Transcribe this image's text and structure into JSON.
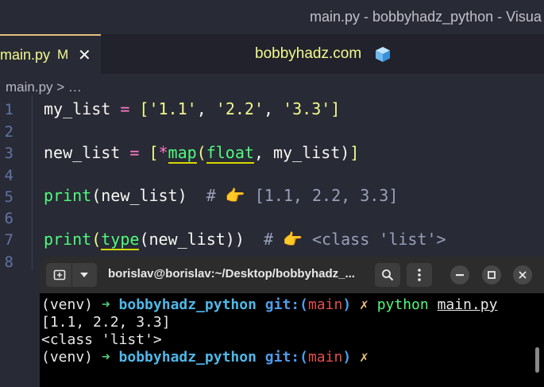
{
  "window": {
    "title": "main.py - bobbyhadz_python - Visua"
  },
  "tabs": [
    {
      "label": "main.py",
      "modified": "M"
    }
  ],
  "center_title": "bobbyhadz.com",
  "breadcrumb": "main.py > …",
  "editor": {
    "line_numbers": [
      "1",
      "2",
      "3",
      "4",
      "5",
      "6",
      "7",
      "8"
    ],
    "line1": {
      "var": "my_list",
      "op": " = ",
      "open": "[",
      "s1": "'1.1'",
      "c1": ", ",
      "s2": "'2.2'",
      "c2": ", ",
      "s3": "'3.3'",
      "close": "]"
    },
    "line3": {
      "var": "new_list",
      "op": " = ",
      "open": "[",
      "star": "*",
      "map": "map",
      "p1": "(",
      "float": "float",
      "rest": ", my_list)",
      "close": "]"
    },
    "line5": {
      "fn": "print",
      "args": "(new_list)",
      "comment": "  # 👉 [1.1, 2.2, 3.3]"
    },
    "line7": {
      "fn": "print",
      "p1": "(",
      "type": "type",
      "args": "(new_list))",
      "comment": "  # 👉 <class 'list'>"
    }
  },
  "terminal": {
    "title": "borislav@borislav:~/Desktop/bobbyhadz_...",
    "lines": {
      "l1": {
        "venv": "(venv) ",
        "arrow": "➜ ",
        "dir": "bobbyhadz_python ",
        "git": "git:(",
        "branch": "main",
        "gitclose": ") ",
        "x": "✗ ",
        "cmd": "python ",
        "file": "main.py"
      },
      "l2": "[1.1, 2.2, 3.3]",
      "l3": "<class 'list'>",
      "l4": {
        "venv": "(venv) ",
        "arrow": "➜ ",
        "dir": "bobbyhadz_python ",
        "git": "git:(",
        "branch": "main",
        "gitclose": ") ",
        "x": "✗"
      }
    }
  },
  "colors": {
    "editor_bg": "#282a36",
    "accent_yellow": "#f1fa8c",
    "keyword_green": "#50fa7b",
    "operator_pink": "#ff79c6"
  }
}
